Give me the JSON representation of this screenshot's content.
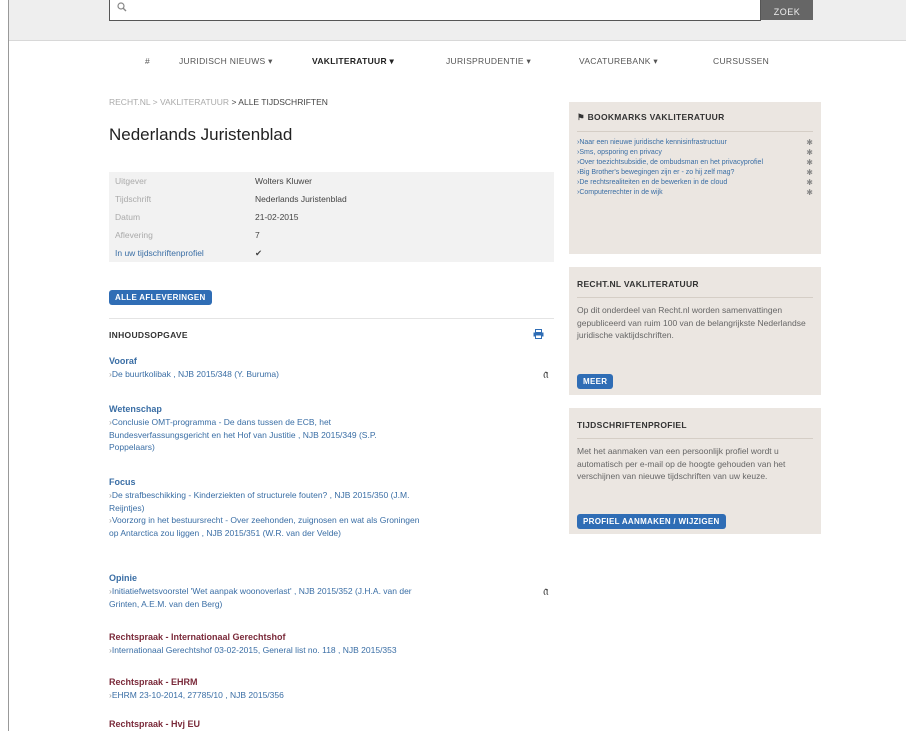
{
  "search": {
    "button_label": "ZOEK",
    "placeholder": ""
  },
  "nav": {
    "home_glyph": "#",
    "items": [
      "JURIDISCH NIEUWS ▾",
      "VAKLITERATUUR ▾",
      "JURISPRUDENTIE ▾",
      "VACATUREBANK ▾",
      "CURSUSSEN"
    ],
    "active_index": 1
  },
  "breadcrumb": {
    "parts": [
      "RECHT.NL",
      "> VAKLITERATUUR"
    ],
    "current": "> ALLE TIJDSCHRIFTEN"
  },
  "page_title": "Nederlands Juristenblad",
  "meta": [
    {
      "key": "Uitgever",
      "value": "Wolters Kluwer"
    },
    {
      "key": "Tijdschrift",
      "value": "Nederlands Juristenblad"
    },
    {
      "key": "Datum",
      "value": "21-02-2015"
    },
    {
      "key": "Aflevering",
      "value": "7"
    },
    {
      "key": "In uw tijdschriftenprofiel",
      "value": "✔"
    }
  ],
  "all_issues_label": "ALLE AFLEVERINGEN",
  "toc": {
    "heading": "INHOUDSOPGAVE",
    "sections": [
      {
        "title": "Vooraf",
        "lines": [
          "De buurtkolibak , NJB 2015/348 (Y. Buruma)"
        ]
      },
      {
        "title": "Wetenschap",
        "lines": [
          "Conclusie OMT-programma - De dans tussen de ECB, het",
          "Bundesverfassungsgericht en het Hof van Justitie , NJB 2015/349 (S.P.",
          "Poppelaars)"
        ]
      },
      {
        "title": "Focus",
        "lines": [
          "De strafbeschikking - Kinderziekten of structurele fouten? , NJB 2015/350 (J.M.",
          "Reijntjes)",
          "Voorzorg in het bestuursrecht - Over zeehonden, zuignosen en wat als Groningen",
          "op Antarctica zou liggen , NJB 2015/351 (W.R. van der Velde)"
        ]
      },
      {
        "title": "Opinie",
        "lines": [
          "Initiatiefwetsvoorstel 'Wet aanpak woonoverlast' , NJB 2015/352 (J.H.A. van der",
          "Grinten, A.E.M. van den Berg)"
        ]
      },
      {
        "title": "Rechtspraak - Internationaal Gerechtshof",
        "lines": [
          "Internationaal Gerechtshof 03-02-2015, General list no. 118 , NJB 2015/353"
        ]
      },
      {
        "title": "Rechtspraak - EHRM",
        "lines": [
          "EHRM 23-10-2014, 27785/10 , NJB 2015/356"
        ]
      },
      {
        "title": "Rechtspraak - Hvj EU",
        "lines": []
      }
    ]
  },
  "bookmarks": {
    "title": "BOOKMARKS VAKLITERATUUR",
    "items": [
      "Naar een nieuwe juridische kennisinfrastructuur",
      "Sms, opsporing en privacy",
      "Over toezichtsubsidie, de ombudsman en het privacyprofiel",
      "Big Brother's bewegingen zijn er - zo hij zelf mag?",
      "De rechtsrealiteiten en de bewerken in de cloud",
      "Computerrechter in de wijk"
    ]
  },
  "vakliteratuur_box": {
    "title": "RECHT.NL VAKLITERATUUR",
    "text": "Op dit onderdeel van Recht.nl worden samenvattingen gepubliceerd van ruim 100 van de belangrijkste Nederlandse juridische vaktijdschriften.",
    "button": "MEER"
  },
  "profiel_box": {
    "title": "TIJDSCHRIFTENPROFIEL",
    "text": "Met het aanmaken van een persoonlijk profiel wordt u automatisch per e-mail op de hoogte gehouden van het verschijnen van nieuwe tijdschriften van uw keuze.",
    "button": "PROFIEL AANMAKEN / WIJZIGEN"
  },
  "colors": {
    "link": "#3a6ea5",
    "button": "#2f6db5",
    "sidebar_bg": "#ebe6e1",
    "section_dark": "#7a2a3a"
  }
}
